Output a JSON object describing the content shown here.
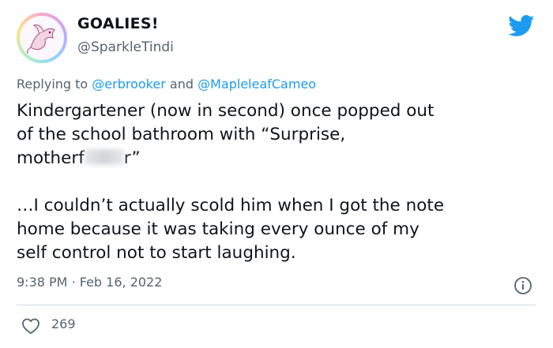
{
  "author": {
    "display_name": "GOALIES!",
    "handle": "@SparkleTindi",
    "avatar_icon": "dragon-avatar"
  },
  "brand": {
    "icon": "twitter-bird-icon",
    "color": "#1d9bf0"
  },
  "reply": {
    "prefix": "Replying to",
    "mention_1": "@erbrooker",
    "joiner": "and",
    "mention_2": "@MapleleafCameo"
  },
  "tweet": {
    "text_part_1": "Kindergartener (now in second) once popped out\nof the school bathroom with “Surprise,\nmotherf",
    "text_part_2": "r”\n\n…I couldn’t actually scold him when I got the note\nhome because it was taking every ounce of my\nself control not to start laughing."
  },
  "meta": {
    "time": "9:38 PM",
    "separator": "·",
    "date": "Feb 16, 2022",
    "info_icon": "info-icon"
  },
  "engagement": {
    "like_icon": "heart-icon",
    "likes": "269"
  }
}
